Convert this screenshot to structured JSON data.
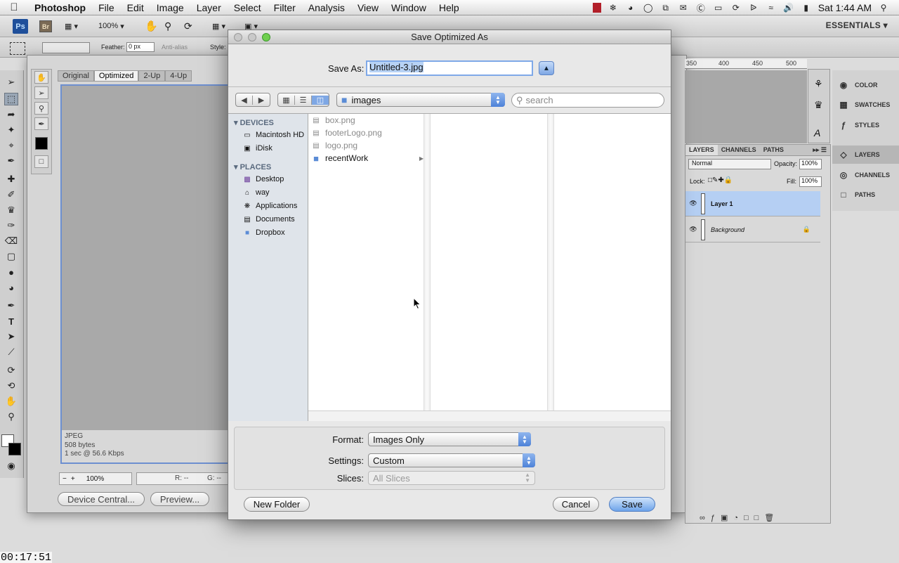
{
  "menubar": {
    "app_name": "Photoshop",
    "menus": [
      "File",
      "Edit",
      "Image",
      "Layer",
      "Select",
      "Filter",
      "Analysis",
      "View",
      "Window",
      "Help"
    ],
    "clock": "Sat 1:44 AM"
  },
  "appbar": {
    "ps_logo": "Ps",
    "br_logo": "Br",
    "zoom": "100%",
    "workspace": "ESSENTIALS"
  },
  "optbar": {
    "feather_label": "Feather:",
    "feather_value": "0 px",
    "antialias_label": "Anti-alias",
    "style_label": "Style:"
  },
  "save_for_web": {
    "tabs": [
      "Original",
      "Optimized",
      "2-Up",
      "4-Up"
    ],
    "active_tab": "Optimized",
    "info_format": "JPEG",
    "info_size": "508 bytes",
    "info_speed": "1 sec @ 56.6 Kbps",
    "zoom": "100%",
    "readout_r": "R: --",
    "readout_g": "G: --",
    "device_central_button": "Device Central...",
    "preview_button": "Preview..."
  },
  "ruler": {
    "marks": [
      "350",
      "400",
      "450",
      "500"
    ]
  },
  "layers_panel": {
    "tabs": [
      "LAYERS",
      "CHANNELS",
      "PATHS"
    ],
    "blend_mode": "Normal",
    "opacity_label": "Opacity:",
    "opacity_value": "100%",
    "lock_label": "Lock:",
    "fill_label": "Fill:",
    "fill_value": "100%",
    "layers": [
      {
        "name": "Layer 1",
        "selected": true
      },
      {
        "name": "Background",
        "selected": false
      }
    ]
  },
  "dock": {
    "items": [
      {
        "label": "COLOR",
        "icon": "color-icon"
      },
      {
        "label": "SWATCHES",
        "icon": "swatches-icon"
      },
      {
        "label": "STYLES",
        "icon": "styles-icon"
      },
      {
        "label": "LAYERS",
        "icon": "layers-icon"
      },
      {
        "label": "CHANNELS",
        "icon": "channels-icon"
      },
      {
        "label": "PATHS",
        "icon": "paths-icon"
      }
    ]
  },
  "dialog": {
    "title": "Save Optimized As",
    "save_as_label": "Save As:",
    "filename": "Untitled-3.jpg",
    "location": "images",
    "search_placeholder": "search",
    "sidebar": {
      "devices_heading": "DEVICES",
      "devices": [
        "Macintosh HD",
        "iDisk"
      ],
      "places_heading": "PLACES",
      "places": [
        "Desktop",
        "way",
        "Applications",
        "Documents",
        "Dropbox"
      ]
    },
    "files": [
      {
        "name": "box.png",
        "kind": "file"
      },
      {
        "name": "footerLogo.png",
        "kind": "file"
      },
      {
        "name": "logo.png",
        "kind": "file"
      },
      {
        "name": "recentWork",
        "kind": "folder"
      }
    ],
    "format_label": "Format:",
    "format_value": "Images Only",
    "settings_label": "Settings:",
    "settings_value": "Custom",
    "slices_label": "Slices:",
    "slices_value": "All Slices",
    "new_folder_button": "New Folder",
    "cancel_button": "Cancel",
    "save_button": "Save"
  },
  "timecode": "00:17:51"
}
